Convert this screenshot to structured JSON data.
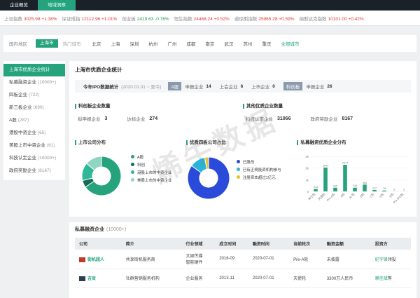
{
  "topbar": {
    "tabs": [
      "企业概览",
      "地域洞察"
    ]
  },
  "ticker": [
    {
      "name": "上证指数",
      "value": "3025.98",
      "chg": "+1.38%",
      "dir": "up"
    },
    {
      "name": "深证成指",
      "value": "12112.96",
      "chg": "+1.01%",
      "dir": "up"
    },
    {
      "name": "创业板",
      "value": "2419.63",
      "chg": "-0.76%",
      "dir": "down"
    },
    {
      "name": "恒生指数",
      "value": "24468.24",
      "chg": "+0.52%",
      "dir": "up"
    },
    {
      "name": "道琼斯指数",
      "value": "25965.28",
      "chg": "+0.59%",
      "dir": "up"
    },
    {
      "name": "纳斯达克指数",
      "value": "10101.00",
      "chg": "+0.42%",
      "dir": "up"
    }
  ],
  "region": {
    "label": "国内地区",
    "selected": "上海市",
    "hot": "热门城市:",
    "cities": [
      "北京",
      "上海",
      "深圳",
      "杭州",
      "广州",
      "成都",
      "南京",
      "武汉",
      "苏州",
      "重庆"
    ],
    "all": "全部城市"
  },
  "sidebar": [
    {
      "label": "上海市优质企业统计",
      "count": ""
    },
    {
      "label": "私募融资企业",
      "count": "(10000+)"
    },
    {
      "label": "四板企业",
      "count": "(722)"
    },
    {
      "label": "新三板企业",
      "count": "(690)"
    },
    {
      "label": "A股",
      "count": "(287)"
    },
    {
      "label": "港股中资企业",
      "count": "(65)"
    },
    {
      "label": "美股上市中资企业",
      "count": "(61)"
    },
    {
      "label": "科技认定企业",
      "count": "(10000+)"
    },
    {
      "label": "政府奖励企业",
      "count": "(8167)"
    }
  ],
  "main": {
    "title": "上海市优质企业统计",
    "ipo": {
      "title": "今年IPO数据统计",
      "date": "(2020.01.01 ~ 至今)",
      "a_tag": "A股",
      "a_applying_label": "申报企业",
      "a_applying": "14",
      "a_listed_label": "上会企业",
      "a_listed": "6",
      "a_listing_label": "上市企业",
      "a_listing": "0",
      "kcb_tag": "科创板",
      "kcb_label": "申报企业",
      "kcb_value": "26"
    },
    "kcb": {
      "title": "科创板企业数量",
      "k1": "拟申报企业",
      "v1": "3",
      "k2": "达标企业",
      "v2": "274"
    },
    "other": {
      "title": "其他优质企业数量",
      "k1": "科技认定企业",
      "v1": "31066",
      "k2": "政府奖励企业",
      "v2": "8167"
    },
    "listed_dist": {
      "title": "上市公司分布",
      "legend": [
        "A股",
        "科创",
        "港股上市的中资企业",
        "美股上市的中资企业"
      ]
    },
    "four_board": {
      "title": "优质四板公司占比",
      "legend": [
        "已股改",
        "已有正规投资机构参与",
        "注册资本超过1亿元"
      ]
    },
    "pe_dist": {
      "title": "私募融资优质企业分布"
    }
  },
  "chart_data": [
    {
      "type": "pie",
      "title": "上市公司分布",
      "categories": [
        "A股",
        "科创",
        "港股上市的中资企业",
        "美股上市的中资企业"
      ],
      "values": [
        287,
        26,
        65,
        61
      ],
      "colors": [
        "#24a37c",
        "#166b55",
        "#2fb898",
        "#8fd6c2"
      ]
    },
    {
      "type": "pie",
      "title": "优质四板公司占比",
      "categories": [
        "已股改",
        "已有正规投资机构参与",
        "注册资本超过1亿元"
      ],
      "values": [
        85,
        12,
        3
      ],
      "colors": [
        "#2a4bd9",
        "#27b6d9",
        "#e8c22b"
      ]
    },
    {
      "type": "bar",
      "title": "私募融资优质企业分布",
      "categories": [
        "种子轮",
        "天使轮",
        "Pre-A轮",
        "A轮",
        "A+轮",
        "B轮",
        "C轮",
        "D轮",
        "E轮",
        "Pre-IPO轮"
      ],
      "values": [
        213,
        2041,
        315,
        2277,
        318,
        584,
        127,
        76,
        5,
        3
      ],
      "ylim": [
        0,
        3000
      ],
      "yticks": [
        "3k",
        "2k",
        "1k",
        "0"
      ]
    }
  ],
  "bottom": {
    "title": "私募融资企业",
    "count": "(10000+)",
    "columns": [
      "公司",
      "简介",
      "行业领域",
      "成立时间",
      "融资时间",
      "当前轮次",
      "融资金额",
      "投资方"
    ],
    "rows": [
      {
        "company": "街机超人",
        "intro": "共享街机服务商",
        "industry": "文娱传媒\n智能硬件",
        "founded": "2016-09",
        "date": "2020-07-01",
        "round": "Pre-A轮",
        "amount": "未披露",
        "investor": "纪字锋",
        "inv_suffix": "领投"
      },
      {
        "company": "吉贡",
        "intro": "社群营销服务机构",
        "industry": "企业服务",
        "founded": "2013-11",
        "date": "2020-07-01",
        "round": "天使轮",
        "amount": "3300万人民币",
        "investor": "赖佳斌",
        "inv_suffix": "等"
      }
    ]
  },
  "watermark": "烯牛数据",
  "colors": {
    "accent": "#24a37c",
    "dark": "#1b2128"
  }
}
